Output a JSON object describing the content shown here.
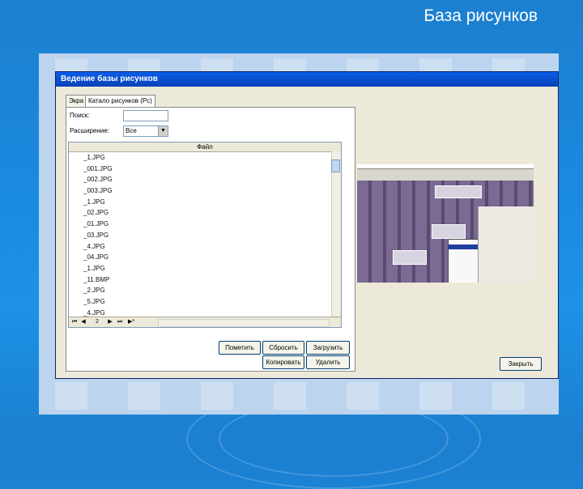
{
  "slide": {
    "title": "База рисунков"
  },
  "window": {
    "title": "Ведение базы рисунков",
    "tabs": [
      "Экра",
      "Катало",
      "рисунков (Рс)"
    ],
    "search_label": "Поиск:",
    "search_value": "",
    "ext_label": "Расширение:",
    "ext_value": "Все",
    "grid_header": "Файл",
    "files": [
      "_1.JPG",
      "_001.JPG",
      "_002.JPG",
      "_003.JPG",
      "_1.JPG",
      "_02.JPG",
      "_01.JPG",
      "_03.JPG",
      "_4.JPG",
      "_04.JPG",
      "_1.JPG",
      "_11.BMP",
      "_2.JPG",
      "_5.JPG",
      "_4.JPG"
    ],
    "page_number": "2",
    "buttons": {
      "mark": "Пометить",
      "reset": "Сбросить",
      "load": "Загрузить",
      "copy": "Копировать",
      "delete": "Удалить",
      "close": "Закрыть"
    }
  },
  "colors": {
    "slide_bg": "#1a8ae0",
    "titlebar": "#0a5ee8",
    "window_bg": "#ece9d8"
  }
}
